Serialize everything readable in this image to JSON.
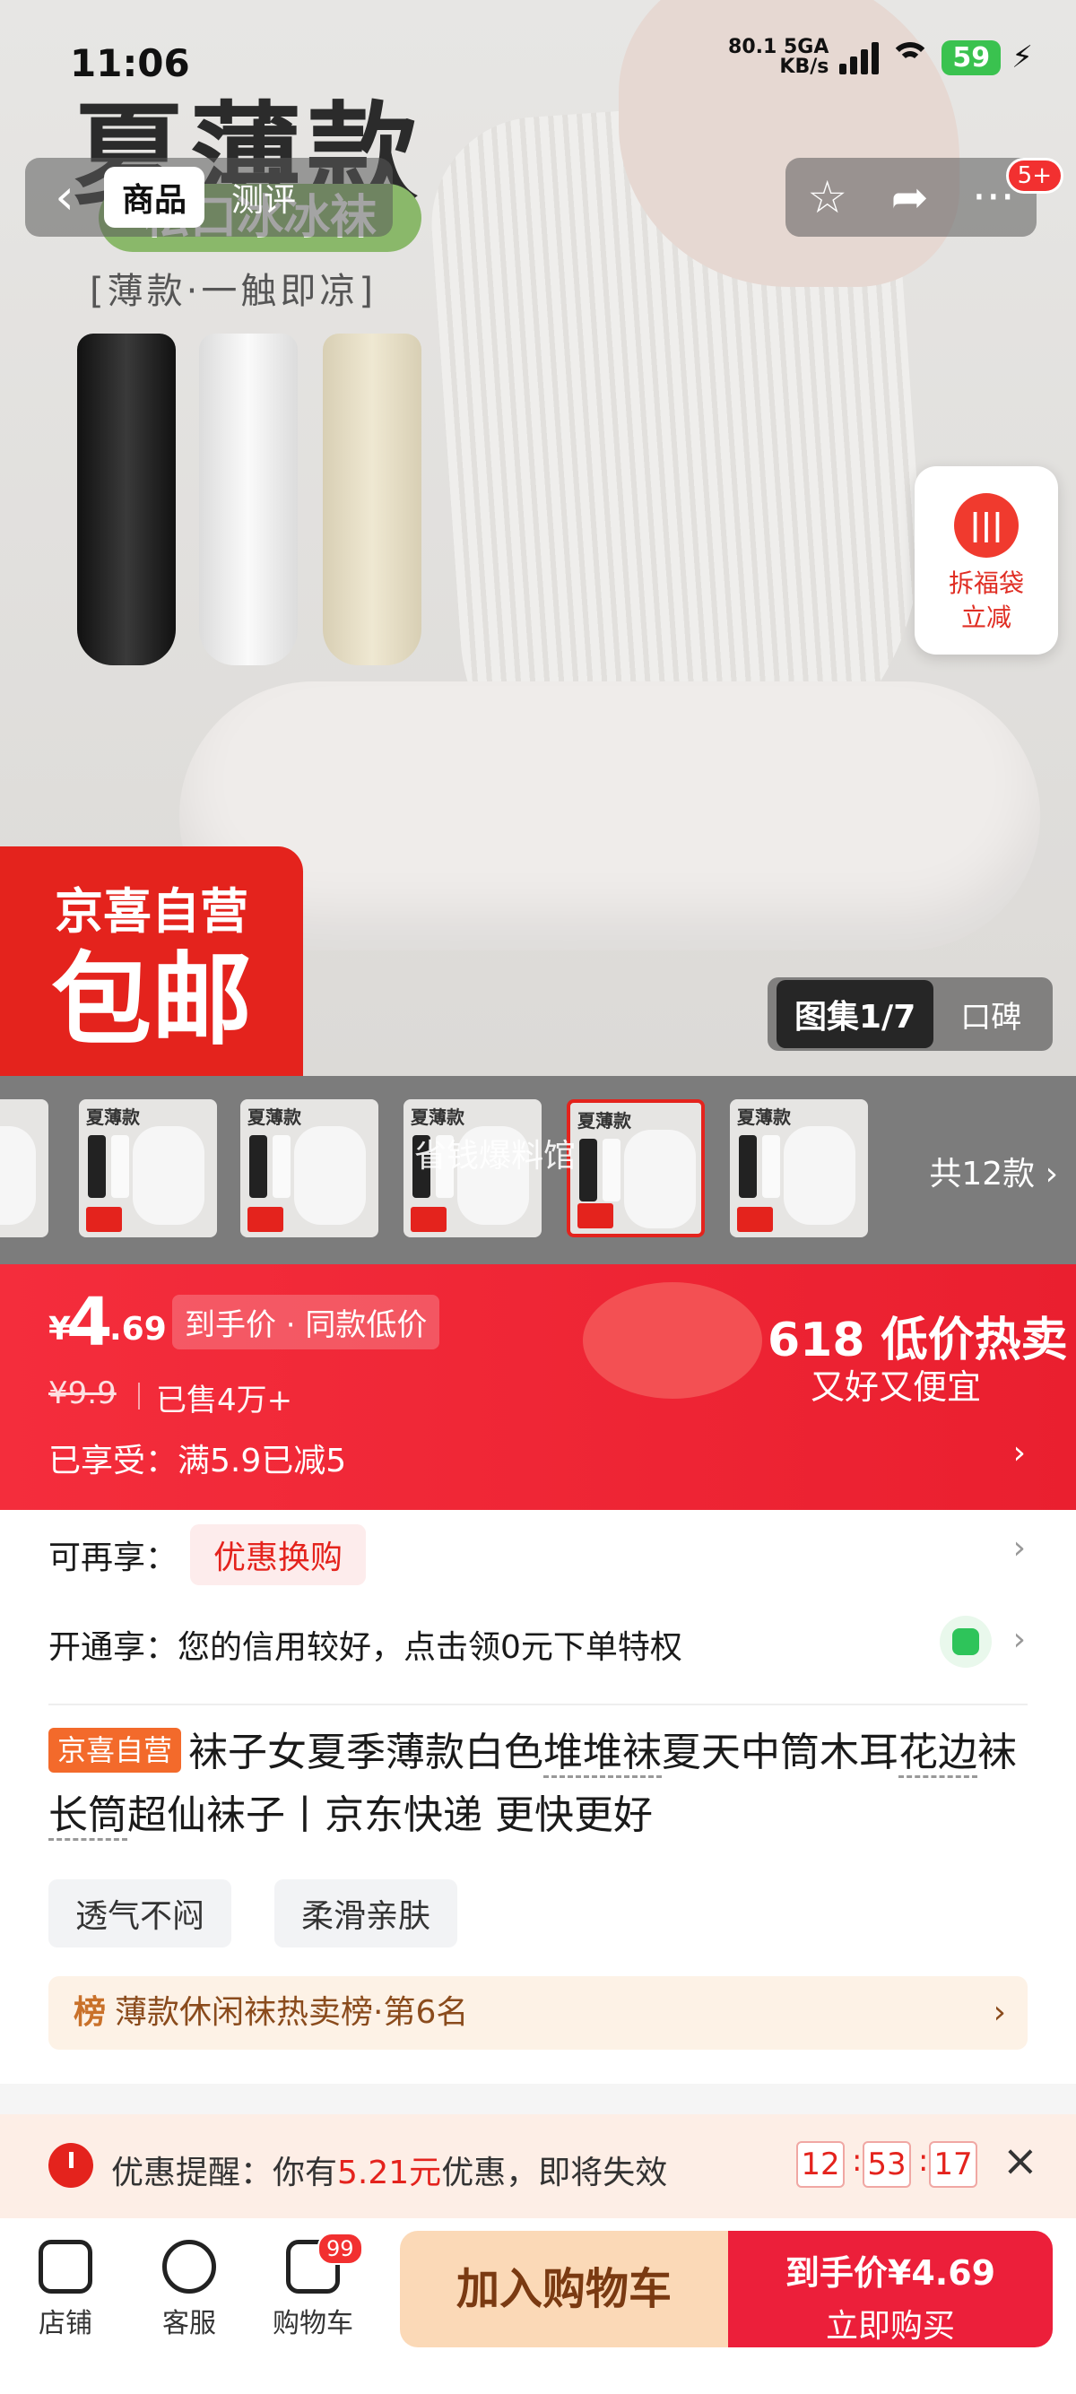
{
  "status_bar": {
    "time": "11:06",
    "network_speed": "80.1",
    "network_unit": "KB/s",
    "network_type": "5GA",
    "battery": "59"
  },
  "hero": {
    "title": "夏薄款",
    "banner": "松口冰冰袜",
    "subtitle": "[薄款·一触即凉]",
    "store_badge_top": "京喜自营",
    "store_badge_bottom": "包邮"
  },
  "nav": {
    "tab_goods": "商品",
    "tab_review": "测评",
    "more_badge": "5+"
  },
  "lucky_bag": {
    "line1": "拆福袋",
    "line2": "立减"
  },
  "gallery": {
    "active_label": "图集1/7",
    "other_label": "口碑",
    "overlay_text": "省钱爆料馆",
    "more_label": "共12款"
  },
  "thumb_text": {
    "title": "夏薄款"
  },
  "price": {
    "currency": "¥",
    "integer": "4",
    "decimal": ".69",
    "tag": "到手价 · 同款低价",
    "original": "¥9.9",
    "sold": "已售4万+",
    "promo_title": "618 低价热卖",
    "promo_sub": "又好又便宜",
    "enjoyed": "已享受：满5.9已减5"
  },
  "offers": {
    "more_label": "可再享：",
    "more_chip": "优惠换购",
    "open_label": "开通享：您的信用较好，点击领0元下单特权"
  },
  "product": {
    "store_tag": "京喜自营",
    "title_a": "袜子女夏季薄款白色",
    "kw1": "堆堆袜",
    "title_b": "夏天中筒木耳",
    "kw2": "花边",
    "title_c": "袜",
    "kw3": "长筒",
    "title_d": "超仙袜子丨京东快递 更快更好",
    "feature_1": "透气不闷",
    "feature_2": "柔滑亲肤",
    "rank_icon": "榜",
    "rank_text": "薄款休闲袜热卖榜·第6名"
  },
  "reminder": {
    "prefix": "优惠提醒：你有",
    "amount": "5.21元",
    "suffix": "优惠，即将失效",
    "hh": "12",
    "mm": "53",
    "ss": "17"
  },
  "bottom_bar": {
    "store": "店铺",
    "service": "客服",
    "cart": "购物车",
    "cart_badge": "99",
    "add_to_cart": "加入购物车",
    "buy_top": "到手价¥4.69",
    "buy_bottom": "立即购买"
  },
  "colors": {
    "accent_red": "#e4231d",
    "promo_red": "#f42d3c",
    "cart_btn": "#fbd9b7",
    "buy_btn": "#ec1f3a"
  },
  "icons": [
    "back-icon",
    "star-icon",
    "share-icon",
    "more-icon",
    "lucky-bag-icon",
    "clock-icon",
    "close-icon",
    "store-icon",
    "service-icon",
    "cart-icon",
    "credit-icon"
  ]
}
